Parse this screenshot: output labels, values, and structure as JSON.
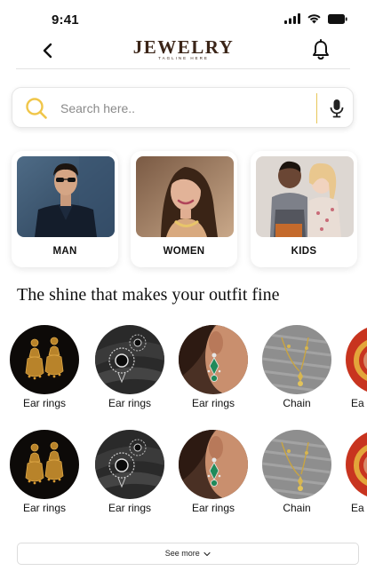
{
  "status_bar": {
    "time": "9:41",
    "icons": [
      "signal-icon",
      "wifi-icon",
      "battery-icon"
    ]
  },
  "header": {
    "logo_text": "JEWELRY",
    "logo_tagline": "TAGLINE HERE",
    "back_icon": "chevron-left-icon",
    "notification_icon": "bell-icon"
  },
  "search": {
    "placeholder": "Search here..",
    "search_icon": "search-icon",
    "mic_icon": "microphone-icon"
  },
  "categories": [
    {
      "label": "MAN"
    },
    {
      "label": "WOMEN"
    },
    {
      "label": "KIDS"
    }
  ],
  "tagline": "The shine that makes your outfit fine",
  "products_row1": [
    {
      "label": "Ear rings"
    },
    {
      "label": "Ear rings"
    },
    {
      "label": "Ear rings"
    },
    {
      "label": "Chain"
    },
    {
      "label": "Ea"
    }
  ],
  "products_row2": [
    {
      "label": "Ear rings"
    },
    {
      "label": "Ear rings"
    },
    {
      "label": "Ear rings"
    },
    {
      "label": "Chain"
    },
    {
      "label": "Ea"
    }
  ],
  "see_more": {
    "label": "See more",
    "icon": "chevron-down-icon"
  },
  "colors": {
    "brand": "#3b2518",
    "accent": "#e8c75a",
    "search_icon": "#f0c64a"
  }
}
